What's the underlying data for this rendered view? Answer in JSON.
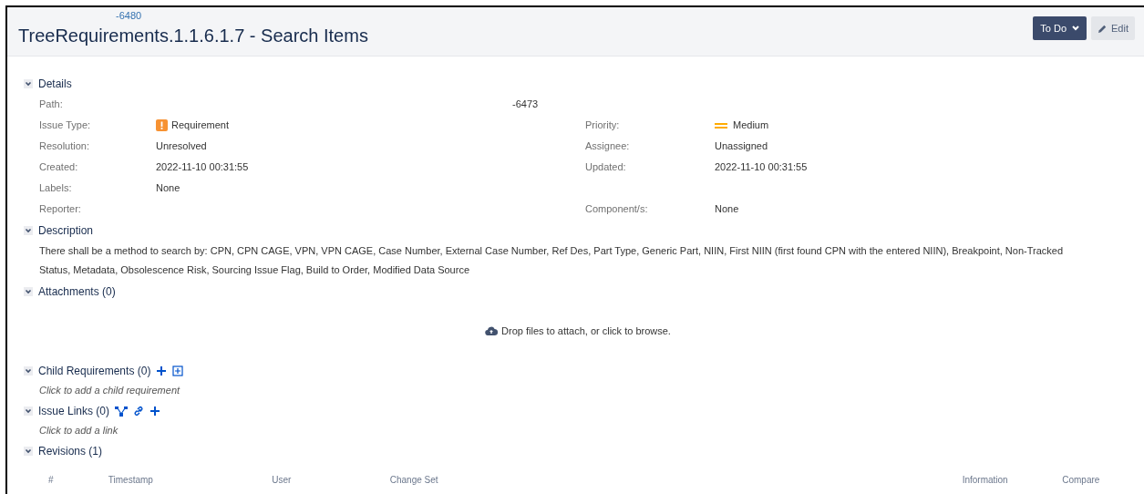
{
  "header": {
    "breadcrumb": "-6480",
    "title": "TreeRequirements.1.1.6.1.7 - Search Items",
    "status_button": "To Do",
    "edit_button": "Edit"
  },
  "sections": [
    {
      "kind": "fields",
      "heading": "Details",
      "expanded": true,
      "rows": [
        {
          "left": {
            "label": "Path:",
            "value": "-6473",
            "kind": "path"
          }
        },
        {
          "left": {
            "label": "Issue Type:",
            "value": "Requirement",
            "kind": "requirement"
          },
          "right": {
            "label": "Priority:",
            "value": "Medium",
            "kind": "priority"
          }
        },
        {
          "left": {
            "label": "Resolution:",
            "value": "Unresolved"
          },
          "right": {
            "label": "Assignee:",
            "value": "Unassigned"
          }
        },
        {
          "left": {
            "label": "Created:",
            "value": "2022-11-10 00:31:55"
          },
          "right": {
            "label": "Updated:",
            "value": "2022-11-10 00:31:55"
          }
        },
        {
          "left": {
            "label": "Labels:",
            "value": "None"
          }
        },
        {
          "left": {
            "label": "Reporter:"
          },
          "right": {
            "label": "Component/s:",
            "value": "None"
          }
        }
      ]
    },
    {
      "kind": "text",
      "heading": "Description",
      "expanded": true,
      "text": "There shall be a method to search by: CPN, CPN CAGE, VPN, VPN CAGE, Case Number, External Case Number, Ref Des, Part Type, Generic Part, NIIN, First NIIN (first found CPN with the entered NIIN), Breakpoint, Non-Tracked Status, Metadata, Obsolescence Risk, Sourcing Issue Flag, Build to Order, Modified Data Source"
    },
    {
      "kind": "dropzone",
      "heading": "Attachments (0)",
      "expanded": true,
      "text": "Drop files to attach, or click to browse."
    },
    {
      "kind": "link",
      "heading": "Child Requirements (0)",
      "expanded": true,
      "tools": [
        {
          "kind": "add"
        },
        {
          "kind": "add-box"
        }
      ],
      "text": "Click to add a child requirement"
    },
    {
      "kind": "link",
      "heading": "Issue Links (0)",
      "expanded": true,
      "tools": [
        {
          "kind": "tree"
        },
        {
          "kind": "link"
        },
        {
          "kind": "add"
        }
      ],
      "text": "Click to add a link"
    },
    {
      "kind": "table",
      "heading": "Revisions (1)",
      "expanded": true,
      "columns": [
        "#",
        "Timestamp",
        "User",
        "Change Set",
        "Information",
        "Compare"
      ]
    }
  ]
}
